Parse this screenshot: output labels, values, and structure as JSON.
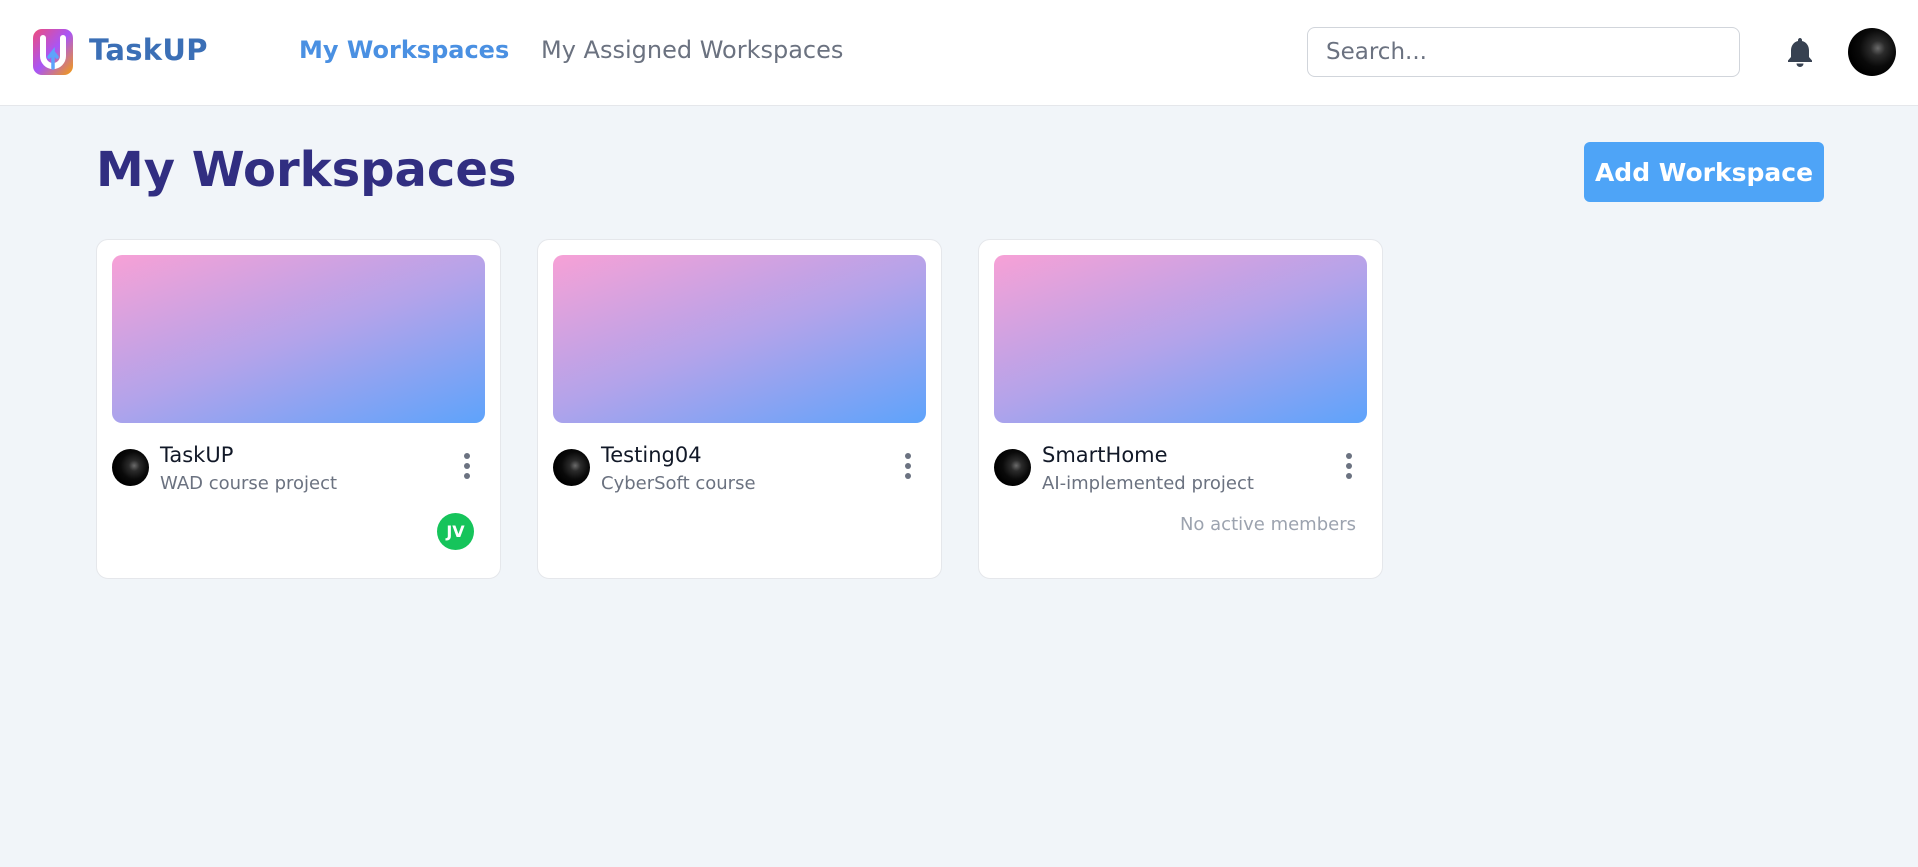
{
  "header": {
    "brand": "TaskUP",
    "nav": [
      {
        "label": "My Workspaces",
        "active": true
      },
      {
        "label": "My Assigned Workspaces",
        "active": false
      }
    ],
    "search_placeholder": "Search...",
    "icons": {
      "logo": "taskup-logo-icon",
      "notifications": "bell-icon",
      "profile": "user-avatar"
    }
  },
  "main": {
    "title": "My Workspaces",
    "add_button_label": "Add Workspace",
    "workspaces": [
      {
        "name": "TaskUP",
        "description": "WAD course project",
        "members": [
          "JV"
        ],
        "members_text": ""
      },
      {
        "name": "Testing04",
        "description": "CyberSoft course",
        "members": [],
        "members_text": ""
      },
      {
        "name": "SmartHome",
        "description": "AI-implemented project",
        "members": [],
        "members_text": "No active members"
      }
    ]
  },
  "colors": {
    "accent": "#4a90e2",
    "title": "#312e81",
    "button": "#4ea4f7",
    "member_badge": "#16c45b",
    "banner_gradient": [
      "#f7a1d6",
      "#b3a3ea",
      "#5ea3fb"
    ]
  }
}
